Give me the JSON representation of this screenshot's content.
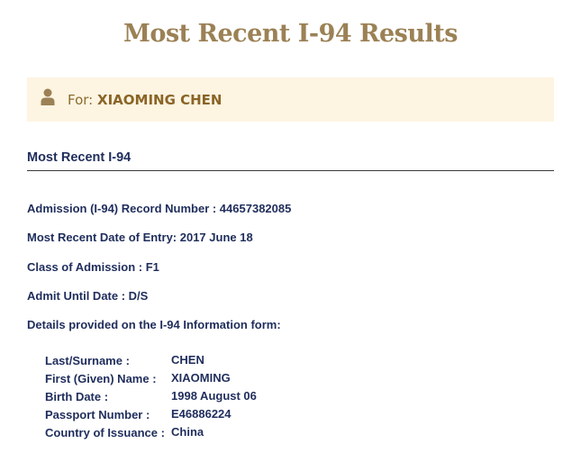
{
  "page": {
    "title": "Most Recent I-94 Results"
  },
  "banner": {
    "prefix": "For:",
    "name": "XIAOMING CHEN",
    "icon": "user-icon",
    "background": "#fdf4e2"
  },
  "section": {
    "heading": "Most Recent I-94"
  },
  "record": {
    "admission_number": "Admission (I-94) Record Number : 44657382085",
    "entry_date": "Most Recent Date of Entry: 2017 June 18",
    "class_of_admission": "Class of Admission : F1",
    "admit_until": "Admit Until Date : D/S",
    "details_intro": "Details provided on the I-94 Information form:"
  },
  "details": [
    {
      "label": "Last/Surname :",
      "value": "CHEN"
    },
    {
      "label": "First (Given) Name :",
      "value": "XIAOMING"
    },
    {
      "label": "Birth Date :",
      "value": "1998 August 06"
    },
    {
      "label": "Passport Number :",
      "value": "E46886224"
    },
    {
      "label": "Country of Issuance :",
      "value": "China"
    }
  ],
  "colors": {
    "title": "#9b8155",
    "text": "#1f2d5c",
    "banner_text": "#8a6d2c"
  }
}
